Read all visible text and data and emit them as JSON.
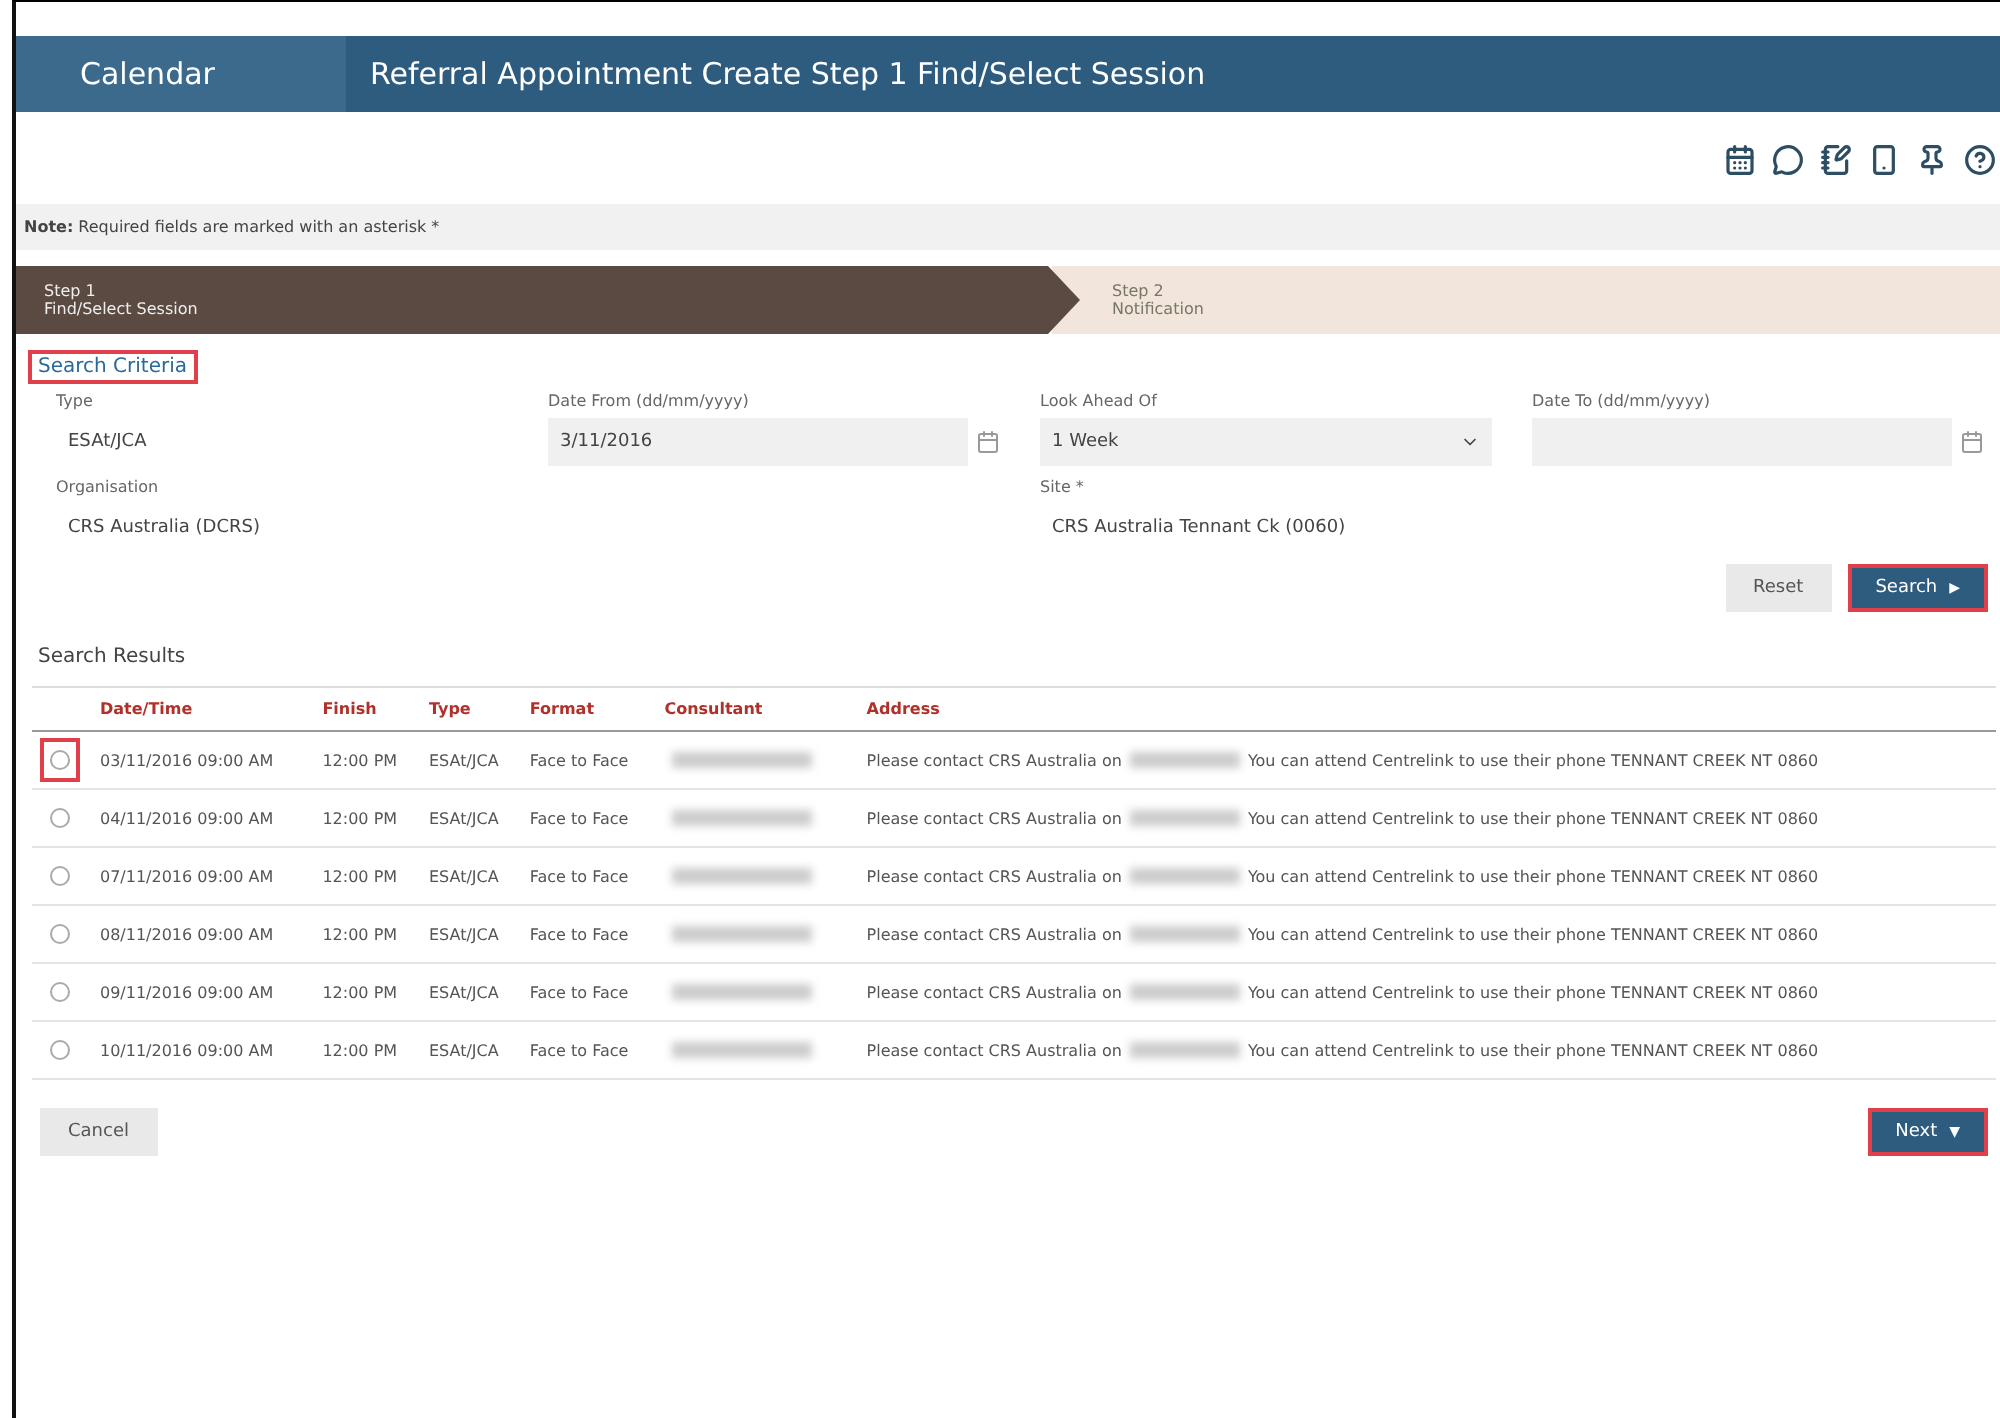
{
  "header": {
    "app": "Calendar",
    "title": "Referral Appointment Create Step 1 Find/Select Session"
  },
  "toolbar_icons": [
    {
      "kind": "calendar"
    },
    {
      "kind": "chat"
    },
    {
      "kind": "notes"
    },
    {
      "kind": "phone"
    },
    {
      "kind": "pin"
    },
    {
      "kind": "help"
    }
  ],
  "note": "**Note:** Required fields are marked with an asterisk *",
  "steps": [
    {
      "title": "Step 1",
      "subtitle": "Find/Select Session",
      "selected": true
    },
    {
      "title": "Step 2",
      "subtitle": "Notification",
      "selected": false
    }
  ],
  "search_criteria": {
    "heading": "Search Criteria",
    "highlighted": true,
    "fields": [
      {
        "label": "Type",
        "value": "ESAt/JCA",
        "kind": "text"
      },
      {
        "label": "Date From (dd/mm/yyyy)",
        "value": "3/11/2016",
        "kind": "date"
      },
      {
        "label": "Look Ahead Of",
        "value": "1 Week",
        "kind": "select"
      },
      {
        "label": "Date To (dd/mm/yyyy)",
        "kind": "date"
      },
      {
        "label": "Organisation",
        "value": "CRS Australia (DCRS)",
        "kind": "text"
      },
      {
        "label": "Site *",
        "value": "CRS Australia Tennant Ck (0060)",
        "kind": "text"
      }
    ],
    "buttons": [
      {
        "label": "Reset",
        "kind": "secondary",
        "highlighted": false
      },
      {
        "label": "Search",
        "kind": "primary",
        "highlighted": true,
        "icon": "▶"
      }
    ]
  },
  "search_results": {
    "heading": "Search Results",
    "columns": [
      "Date/Time",
      "Finish",
      "Type",
      "Format",
      "Consultant",
      "Address"
    ],
    "rows": [
      {
        "selected": false,
        "highlighted": true,
        "date_time": "03/11/2016 09:00 AM",
        "finish": "12:00 PM",
        "type": "ESAt/JCA",
        "format": "Face to Face",
        "address_before": "Please contact CRS Australia on",
        "address_after": "You can attend Centrelink to use their phone TENNANT CREEK NT 0860"
      },
      {
        "selected": false,
        "highlighted": false,
        "date_time": "04/11/2016 09:00 AM",
        "finish": "12:00 PM",
        "type": "ESAt/JCA",
        "format": "Face to Face",
        "address_before": "Please contact CRS Australia on",
        "address_after": "You can attend Centrelink to use their phone TENNANT CREEK NT 0860"
      },
      {
        "selected": false,
        "highlighted": false,
        "date_time": "07/11/2016 09:00 AM",
        "finish": "12:00 PM",
        "type": "ESAt/JCA",
        "format": "Face to Face",
        "address_before": "Please contact CRS Australia on",
        "address_after": "You can attend Centrelink to use their phone TENNANT CREEK NT 0860"
      },
      {
        "selected": false,
        "highlighted": false,
        "date_time": "08/11/2016 09:00 AM",
        "finish": "12:00 PM",
        "type": "ESAt/JCA",
        "format": "Face to Face",
        "address_before": "Please contact CRS Australia on",
        "address_after": "You can attend Centrelink to use their phone TENNANT CREEK NT 0860"
      },
      {
        "selected": false,
        "highlighted": false,
        "date_time": "09/11/2016 09:00 AM",
        "finish": "12:00 PM",
        "type": "ESAt/JCA",
        "format": "Face to Face",
        "address_before": "Please contact CRS Australia on",
        "address_after": "You can attend Centrelink to use their phone TENNANT CREEK NT 0860"
      },
      {
        "selected": false,
        "highlighted": false,
        "date_time": "10/11/2016 09:00 AM",
        "finish": "12:00 PM",
        "type": "ESAt/JCA",
        "format": "Face to Face",
        "address_before": "Please contact CRS Australia on",
        "address_after": "You can attend Centrelink to use their phone TENNANT CREEK NT 0860"
      }
    ]
  },
  "footer_buttons": [
    {
      "label": "Cancel",
      "kind": "secondary",
      "highlighted": false
    },
    {
      "label": "Next",
      "kind": "primary",
      "highlighted": true,
      "icon": "▼"
    }
  ]
}
